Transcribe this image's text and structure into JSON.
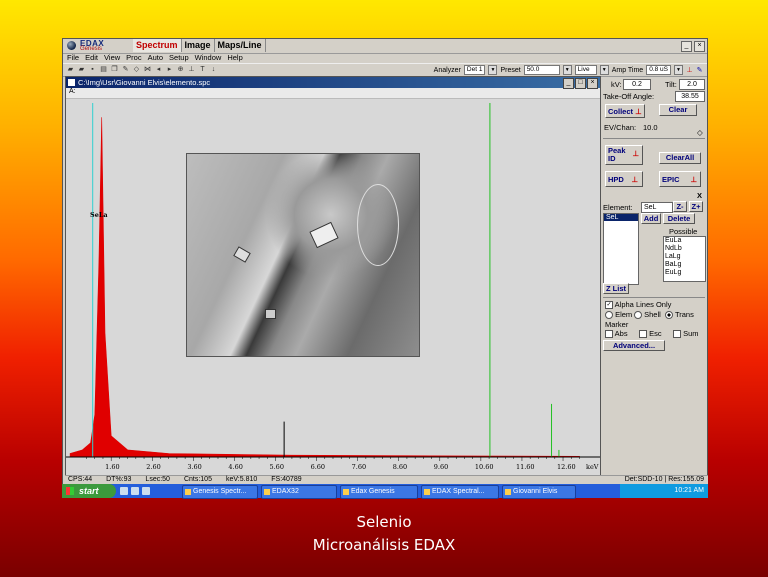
{
  "app": {
    "logo_top": "EDAX",
    "logo_bottom": "Genesis",
    "tabs": [
      "Spectrum",
      "Image",
      "Maps/Line"
    ],
    "menu": [
      "File",
      "Edit",
      "View",
      "Proc",
      "Auto",
      "Setup",
      "Window",
      "Help"
    ]
  },
  "toolbar": {
    "analyzer_label": "Analyzer",
    "analyzer_value": "Det 1",
    "preset_label": "Preset",
    "preset_value": "50.0",
    "live_value": "Live",
    "amp_label": "Amp Time",
    "amp_value": "0.8 uS"
  },
  "spectrum_window": {
    "title": "C:\\Img\\Usr\\Giovanni Elvis\\elemento.spc",
    "toolbar_text": "A:",
    "peak_label": "SeLa",
    "x_ticks": [
      "1.60",
      "2.60",
      "3.60",
      "4.60",
      "5.60",
      "6.60",
      "7.60",
      "8.60",
      "9.60",
      "10.60",
      "11.60",
      "12.60"
    ],
    "x_unit": "keV"
  },
  "status": {
    "cps": "CPS:44",
    "dt": "DT%:93",
    "lsec": "Lsec:50",
    "cnts": "Cnts:105",
    "kev": "keV:5.810",
    "fs": "FS:40789",
    "det": "Det:SDD-10",
    "res": "Res:155.09"
  },
  "panel": {
    "kv_label": "kV:",
    "kv_value": "0.2",
    "tilt_label": "Tilt:",
    "tilt_value": "2.0",
    "takeoff_label": "Take-Off Angle:",
    "takeoff_value": "38.55",
    "collect": "Collect",
    "clear": "Clear",
    "evchan_label": "EV/Chan:",
    "evchan_value": "10.0",
    "peak_id_1": "Peak",
    "peak_id_2": "ID",
    "clear_all": "ClearAll",
    "hpd": "HPD",
    "epic": "EPIC",
    "close_x": "X",
    "element_label": "Element:",
    "element_value": "SeL",
    "zminus": "Z-",
    "zplus": "Z+",
    "add": "Add",
    "delete": "Delete",
    "possible_label": "Possible",
    "element_list": [
      "SeL"
    ],
    "possible_list": [
      "EuLa",
      "NdLb",
      "LaLg",
      "BaLg",
      "EuLg"
    ],
    "zlist": "Z List",
    "alpha_lines": "Alpha Lines Only",
    "elem": "Elem",
    "shell": "Shell",
    "trans": "Trans",
    "marker_label": "Marker",
    "abs": "Abs",
    "esc": "Esc",
    "sum": "Sum",
    "advanced": "Advanced..."
  },
  "taskbar": {
    "start": "start",
    "tasks": [
      "Genesis Spectr...",
      "EDAX32",
      "Edax Genesis",
      "EDAX  Spectral...",
      "Giovanni Elvis"
    ],
    "clock": "10:21 AM"
  },
  "caption": {
    "line1": "Selenio",
    "line2": "Microanálisis EDAX"
  },
  "chart_data": {
    "type": "line",
    "xlabel": "keV",
    "x_ticks": [
      1.6,
      2.6,
      3.6,
      4.6,
      5.6,
      6.6,
      7.6,
      8.6,
      9.6,
      10.6,
      11.6,
      12.6
    ],
    "xlim": [
      0.5,
      13.5
    ],
    "series": [
      {
        "name": "SeLa",
        "x": [
          0.6,
          0.9,
          1.1,
          1.2,
          1.3,
          1.37,
          1.45,
          1.6,
          2.0,
          3.0,
          6.0,
          10.0,
          13.0
        ],
        "y": [
          0.01,
          0.02,
          0.04,
          0.12,
          0.55,
          0.96,
          0.35,
          0.06,
          0.02,
          0.01,
          0.005,
          0.003,
          0.002
        ]
      }
    ],
    "markers_keV": [
      1.15,
      5.81,
      10.82,
      12.32,
      12.5
    ],
    "colors": {
      "spectrum": "#e00000",
      "marker_green": "#22c022",
      "marker_cyan": "#30d0d0",
      "cursor": "#000000"
    }
  }
}
